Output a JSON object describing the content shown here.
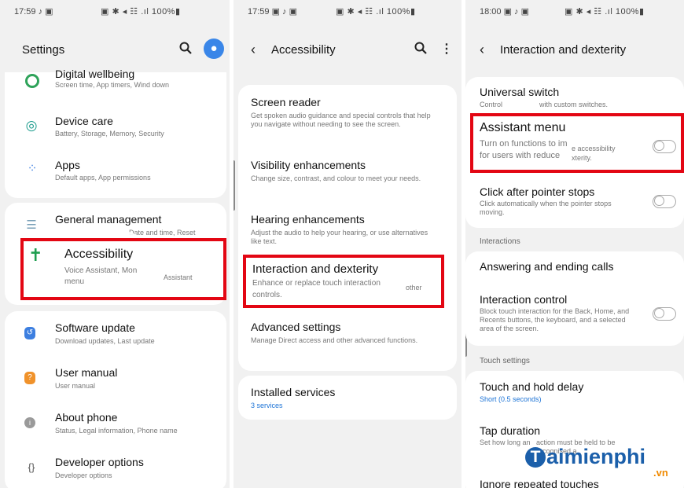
{
  "panel1": {
    "status": {
      "time": "17:59 ♪ ▣",
      "icons": "▣ ✱ ◂ ☷ .ıl 100%▮"
    },
    "title": "Settings",
    "items": [
      {
        "title": "Digital wellbeing",
        "sub": "Screen time, App timers, Wind down",
        "icon": "wellbeing-icon"
      },
      {
        "title": "Device care",
        "sub": "Battery, Storage, Memory, Security",
        "icon": "device-care-icon"
      },
      {
        "title": "Apps",
        "sub": "Default apps, App permissions",
        "icon": "apps-icon"
      },
      {
        "title": "General management",
        "sub": "Date and time, Reset",
        "icon": "sliders-icon"
      },
      {
        "title": "Accessibility",
        "sub": "Voice Assistant, Mon",
        "sub2": "menu",
        "sub3": "Assistant",
        "icon": "accessibility-icon"
      },
      {
        "title": "Software update",
        "sub": "Download updates, Last update",
        "icon": "software-update-icon"
      },
      {
        "title": "User manual",
        "sub": "User manual",
        "icon": "user-manual-icon"
      },
      {
        "title": "About phone",
        "sub": "Status, Legal information, Phone name",
        "icon": "info-icon"
      },
      {
        "title": "Developer options",
        "sub": "Developer options",
        "icon": "braces-icon"
      }
    ]
  },
  "panel2": {
    "status": {
      "time": "17:59 ▣ ♪ ▣",
      "icons": "▣ ✱ ◂ ☷ .ıl 100%▮"
    },
    "title": "Accessibility",
    "items": [
      {
        "title": "Screen reader",
        "sub": "Get spoken audio guidance and special controls that help you navigate without needing to see the screen."
      },
      {
        "title": "Visibility enhancements",
        "sub": "Change size, contrast, and colour to meet your needs."
      },
      {
        "title": "Hearing enhancements",
        "sub": "Adjust the audio to help your hearing, or use alternatives like text."
      },
      {
        "title": "Interaction and dexterity",
        "sub": "Enhance or replace touch interaction",
        "sub2": "controls.",
        "sub3": "other"
      },
      {
        "title": "Advanced settings",
        "sub": "Manage Direct access and other advanced functions."
      },
      {
        "title": "Installed services",
        "sub": "3 services"
      }
    ]
  },
  "panel3": {
    "status": {
      "time": "18:00 ▣ ♪ ▣",
      "icons": "▣ ✱ ◂ ☷ .ıl 100%▮"
    },
    "title": "Interaction and dexterity",
    "items": [
      {
        "title": "Universal switch",
        "sub": "Control",
        "sub2": "with custom switches."
      },
      {
        "title": "Assistant menu",
        "sub": "Turn on functions to im",
        "sub2": "for users with reduce",
        "sub3": "e accessibility",
        "sub4": "xterity."
      },
      {
        "title": "Click after pointer stops",
        "sub": "Click automatically when the pointer stops moving."
      },
      {
        "title": "Answering and ending calls"
      },
      {
        "title": "Interaction control",
        "sub": "Block touch interaction for the Back, Home, and Recents buttons, the keyboard, and a selected area of the screen."
      },
      {
        "title": "Touch and hold delay",
        "sub": "Short (0.5 seconds)"
      },
      {
        "title": "Tap duration",
        "sub": "Set how long an",
        "sub2": "action must be held to be recognised a"
      },
      {
        "title": "Ignore repeated touches"
      }
    ],
    "sections": {
      "interactions": "Interactions",
      "touch": "Touch settings"
    }
  },
  "watermark": {
    "t": "T",
    "name": "aimienphi",
    "domain": ".vn"
  },
  "colors": {
    "highlight": "#e30613",
    "accent": "#3a86e8",
    "link": "#1c73d6"
  }
}
